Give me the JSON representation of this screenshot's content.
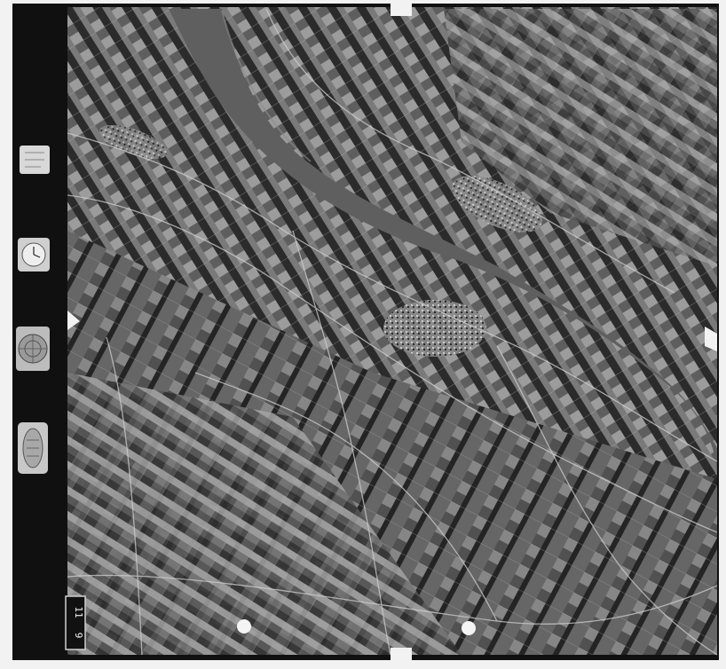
{
  "photo": {
    "type": "aerial-photograph",
    "subject": "river",
    "frame_number": "11 9",
    "frame_number_parts": [
      "11",
      "9"
    ]
  },
  "instrument_strip": {
    "data_card_label": "",
    "altimeter_label": "",
    "level_label": "",
    "clock_label": ""
  },
  "colors": {
    "film_border": "#101010",
    "river": "#5f5f5f",
    "field_dark": "#2a2a2a",
    "field_mid": "#575757",
    "field_light": "#9a9a9a",
    "paper": "#f2f2f2"
  }
}
